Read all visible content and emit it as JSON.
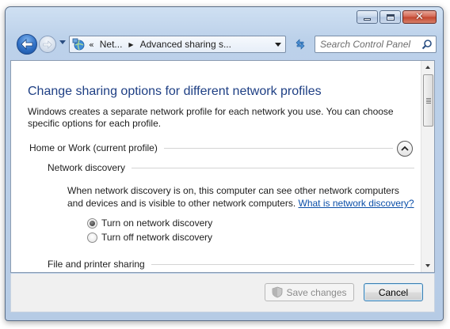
{
  "window": {
    "caption": {
      "minimize_icon": "minimize-icon",
      "maximize_icon": "maximize-icon",
      "close_icon": "close-icon",
      "close_glyph": "✕"
    },
    "accent_color": "#1e3f84",
    "link_color": "#0b4fa8"
  },
  "nav": {
    "back_icon": "back-arrow-icon",
    "forward_icon": "forward-arrow-icon",
    "address": {
      "icon": "network-icon",
      "overflow": "«",
      "crumbs": [
        "Net...",
        "Advanced sharing s..."
      ],
      "separator": "▶"
    },
    "search": {
      "placeholder": "Search Control Panel"
    }
  },
  "content": {
    "title": "Change sharing options for different network profiles",
    "intro": "Windows creates a separate network profile for each network you use. You can choose specific options for each profile.",
    "profile_header": "Home or Work (current profile)",
    "network_discovery": {
      "heading": "Network discovery",
      "description": "When network discovery is on, this computer can see other network computers and devices and is visible to other network computers.",
      "link": "What is network discovery?",
      "options": [
        {
          "label": "Turn on network discovery",
          "selected": true
        },
        {
          "label": "Turn off network discovery",
          "selected": false
        }
      ]
    },
    "file_printer": {
      "heading": "File and printer sharing"
    }
  },
  "footer": {
    "save_label": "Save changes",
    "save_enabled": false,
    "cancel_label": "Cancel"
  }
}
